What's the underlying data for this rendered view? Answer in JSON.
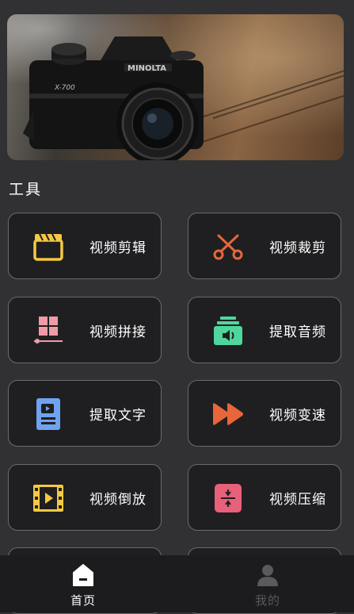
{
  "section_title": "工具",
  "tools": [
    {
      "label": "视频剪辑",
      "icon": "clapperboard-icon",
      "color": "#F5C842"
    },
    {
      "label": "视频裁剪",
      "icon": "scissors-icon",
      "color": "#E8663A"
    },
    {
      "label": "视频拼接",
      "icon": "mosaic-icon",
      "color": "#F09AA8"
    },
    {
      "label": "提取音频",
      "icon": "audio-icon",
      "color": "#4FD69C"
    },
    {
      "label": "提取文字",
      "icon": "document-icon",
      "color": "#6FA3F0"
    },
    {
      "label": "视频变速",
      "icon": "fast-forward-icon",
      "color": "#E8663A"
    },
    {
      "label": "视频倒放",
      "icon": "film-play-icon",
      "color": "#F5C842"
    },
    {
      "label": "视频压缩",
      "icon": "compress-icon",
      "color": "#E8607A"
    }
  ],
  "tabs": [
    {
      "label": "首页",
      "icon": "home-icon",
      "active": true
    },
    {
      "label": "我的",
      "icon": "user-icon",
      "active": false
    }
  ],
  "colors": {
    "background": "#313133",
    "card": "#1F1F21",
    "tab_active": "#FFFFFF",
    "tab_inactive": "#5A5A5C"
  }
}
